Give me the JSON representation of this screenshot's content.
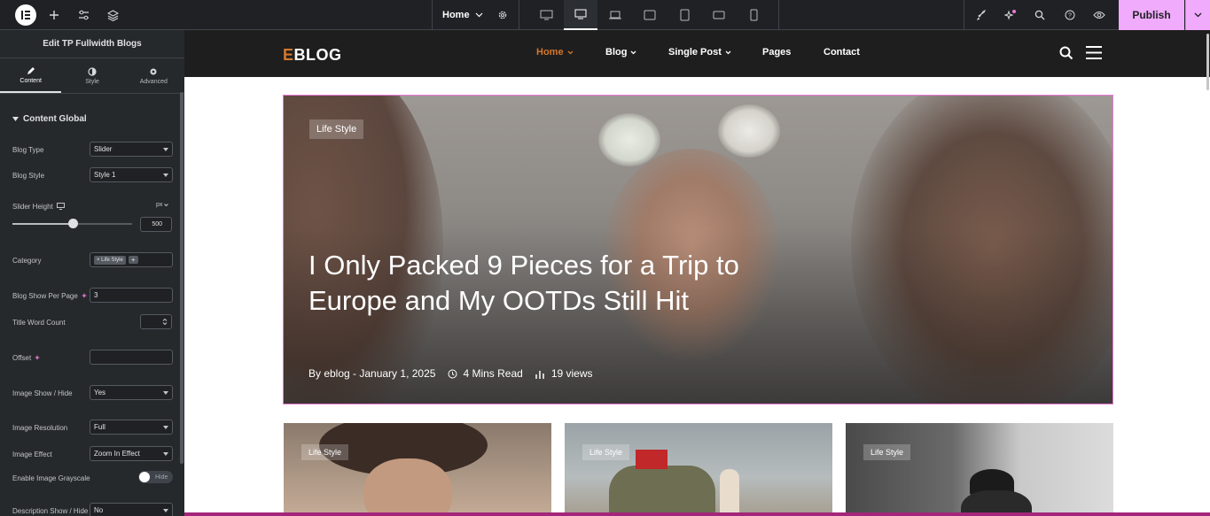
{
  "topbar": {
    "page_selector": "Home",
    "publish_label": "Publish"
  },
  "panel": {
    "title": "Edit TP Fullwidth Blogs",
    "tabs": [
      {
        "label": "Content",
        "icon": "pencil-icon"
      },
      {
        "label": "Style",
        "icon": "contrast-icon"
      },
      {
        "label": "Advanced",
        "icon": "gear-icon"
      }
    ],
    "section_title": "Content Global",
    "fields": {
      "blog_type": {
        "label": "Blog Type",
        "value": "Slider"
      },
      "blog_style": {
        "label": "Blog Style",
        "value": "Style 1"
      },
      "slider_height": {
        "label": "Slider Height",
        "unit": "px",
        "value": "500",
        "level": 0.5
      },
      "category": {
        "label": "Category",
        "tag": "× Life Style",
        "add": "+"
      },
      "blog_show_per_page": {
        "label": "Blog Show Per Page",
        "value": "3"
      },
      "title_word_count": {
        "label": "Title Word Count",
        "value": ""
      },
      "offset": {
        "label": "Offset",
        "value": ""
      },
      "image_show_hide": {
        "label": "Image Show / Hide",
        "value": "Yes"
      },
      "image_resolution": {
        "label": "Image Resolution",
        "value": "Full"
      },
      "image_effect": {
        "label": "Image Effect",
        "value": "Zoom In Effect"
      },
      "enable_image_grayscale": {
        "label": "Enable Image Grayscale",
        "toggle": "Hide"
      },
      "description_show_hide": {
        "label": "Description Show / Hide",
        "value": "No"
      }
    }
  },
  "site": {
    "brand_e": "E",
    "brand_rest": "BLOG",
    "nav": [
      {
        "label": "Home",
        "dropdown": true,
        "active": true
      },
      {
        "label": "Blog",
        "dropdown": true
      },
      {
        "label": "Single Post",
        "dropdown": true
      },
      {
        "label": "Pages",
        "dropdown": false
      },
      {
        "label": "Contact",
        "dropdown": false
      }
    ],
    "hero": {
      "tag": "Life Style",
      "title": "I Only Packed 9 Pieces for a Trip to Europe and My OOTDs Still Hit",
      "author_date": "By eblog - January 1, 2025",
      "read_time": "4 Mins Read",
      "views": "19 views"
    },
    "cards": [
      {
        "tag": "Life Style"
      },
      {
        "tag": "Life Style"
      },
      {
        "tag": "Life Style"
      }
    ]
  },
  "colors": {
    "accent": "#d5772c",
    "publish": "#f0abfc",
    "panel_bg": "#26292c",
    "topbar_bg": "#1f2124"
  }
}
